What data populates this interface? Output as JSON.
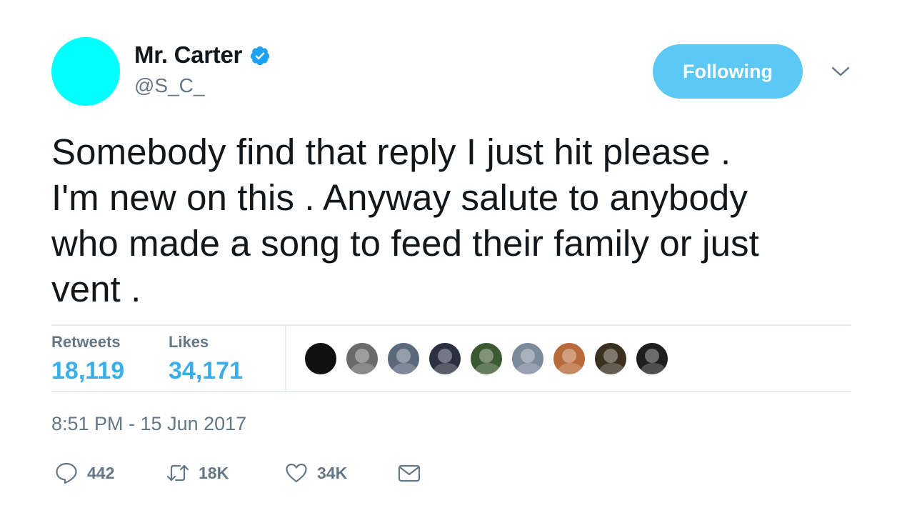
{
  "colors": {
    "avatar": "#00ffff",
    "verified": "#1da1f2",
    "follow_button_bg": "#5bc8f5",
    "stat_value": "#3aaee6",
    "muted": "#657786"
  },
  "author": {
    "display_name": "Mr. Carter",
    "handle": "@S_C_",
    "verified_icon": "verified-badge-icon"
  },
  "follow_button": {
    "label": "Following"
  },
  "menu": {
    "icon": "chevron-down-icon"
  },
  "tweet": {
    "text": "Somebody find that reply I just hit please .\nI'm new on this . Anyway salute to anybody\nwho made a song to feed their family or just\nvent ."
  },
  "stats": {
    "retweets": {
      "label": "Retweets",
      "value": "18,119"
    },
    "likes": {
      "label": "Likes",
      "value": "34,171"
    }
  },
  "likers": [
    {
      "color": "#111111"
    },
    {
      "color": "#6a6a6a"
    },
    {
      "color": "#5a6a7a"
    },
    {
      "color": "#2a3040"
    },
    {
      "color": "#3c5a32"
    },
    {
      "color": "#7a8a9a"
    },
    {
      "color": "#b86a3a"
    },
    {
      "color": "#3a3020"
    },
    {
      "color": "#1e1e1e"
    }
  ],
  "timestamp": "8:51 PM - 15 Jun 2017",
  "actions": {
    "reply": {
      "icon": "reply-icon",
      "count": "442"
    },
    "retweet": {
      "icon": "retweet-icon",
      "count": "18K"
    },
    "like": {
      "icon": "heart-icon",
      "count": "34K"
    },
    "message": {
      "icon": "envelope-icon"
    }
  }
}
